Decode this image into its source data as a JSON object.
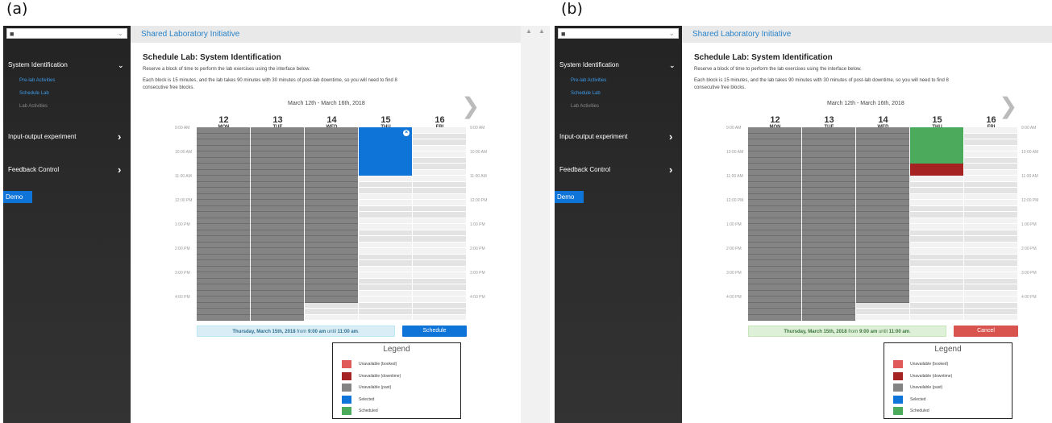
{
  "figure_labels": [
    "(a)",
    "(b)"
  ],
  "app": {
    "title": "Shared Laboratory Initiative",
    "page_title": "Schedule Lab: System Identification",
    "desc1": "Reserve a block of time to perform the lab exercises using the interface below.",
    "desc2": "Each block is 15 minutes, and the lab takes 90 minutes with 30 minutes of post-lab downtime, so you will need to find 8",
    "desc3": "consecutive free blocks.",
    "week_range": "March 12th - March 16th, 2018",
    "demo_label": "Demo"
  },
  "sidebar": {
    "sections": [
      {
        "label": "System Identification",
        "arrow": "⌄"
      },
      {
        "label": "Input-output experiment",
        "arrow": "›"
      },
      {
        "label": "Feedback Control",
        "arrow": "›"
      }
    ],
    "sub_items": [
      {
        "label": "Pre-lab Activities",
        "color": "#3d9be9"
      },
      {
        "label": "Schedule Lab",
        "color": "#3d9be9"
      },
      {
        "label": "Lab Activities",
        "color": "#8a8a8a"
      }
    ]
  },
  "days": [
    {
      "num": "12",
      "dow": "MON"
    },
    {
      "num": "13",
      "dow": "TUE"
    },
    {
      "num": "14",
      "dow": "WED"
    },
    {
      "num": "15",
      "dow": "THU"
    },
    {
      "num": "16",
      "dow": "FRI"
    }
  ],
  "times": [
    "9:00 AM",
    "10:00 AM",
    "11:00 AM",
    "12:00 PM",
    "1:00 PM",
    "2:00 PM",
    "3:00 PM",
    "4:00 PM"
  ],
  "schedule": {
    "blocks_per_day": 32,
    "past_blocks": [
      32,
      32,
      29,
      0,
      0
    ],
    "panel_a": {
      "selected_day": 3,
      "selected_start": 0,
      "selected_count": 8
    },
    "panel_b": {
      "scheduled_day": 3,
      "scheduled_start": 0,
      "scheduled_count": 6,
      "downtime_count": 2
    }
  },
  "summary": {
    "date": "Thursday, March 15th, 2018",
    "from_word": " from ",
    "start": "9:00 am",
    "until_word": " until ",
    "end": "11:00 am",
    "period": "."
  },
  "buttons": {
    "schedule": "Schedule",
    "cancel": "Cancel"
  },
  "legend": {
    "title": "Legend",
    "items": [
      {
        "label": "Unavailable (booked)",
        "color": "#e05a5a"
      },
      {
        "label": "Unavailable (downtime)",
        "color": "#a52323"
      },
      {
        "label": "Unavailable (past)",
        "color": "#848484"
      },
      {
        "label": "Selected",
        "color": "#0e74d8"
      },
      {
        "label": "Scheduled",
        "color": "#4caa5c"
      }
    ]
  }
}
